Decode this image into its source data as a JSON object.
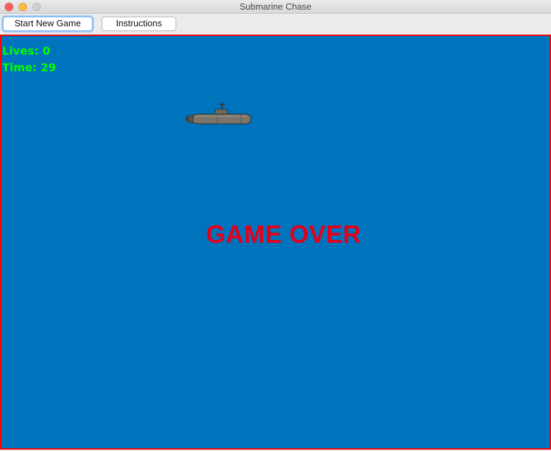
{
  "window": {
    "title": "Submarine Chase"
  },
  "toolbar": {
    "start_label": "Start New Game",
    "instructions_label": "Instructions"
  },
  "game": {
    "lives": "Lives: 0",
    "time": "Time: 29",
    "status": "GAME OVER"
  },
  "colors": {
    "ocean": "#0073bd",
    "border": "#ff0000",
    "hud_text": "#00ff00",
    "game_over_text": "#e4001b"
  },
  "icons": {
    "player": "submarine-icon"
  }
}
